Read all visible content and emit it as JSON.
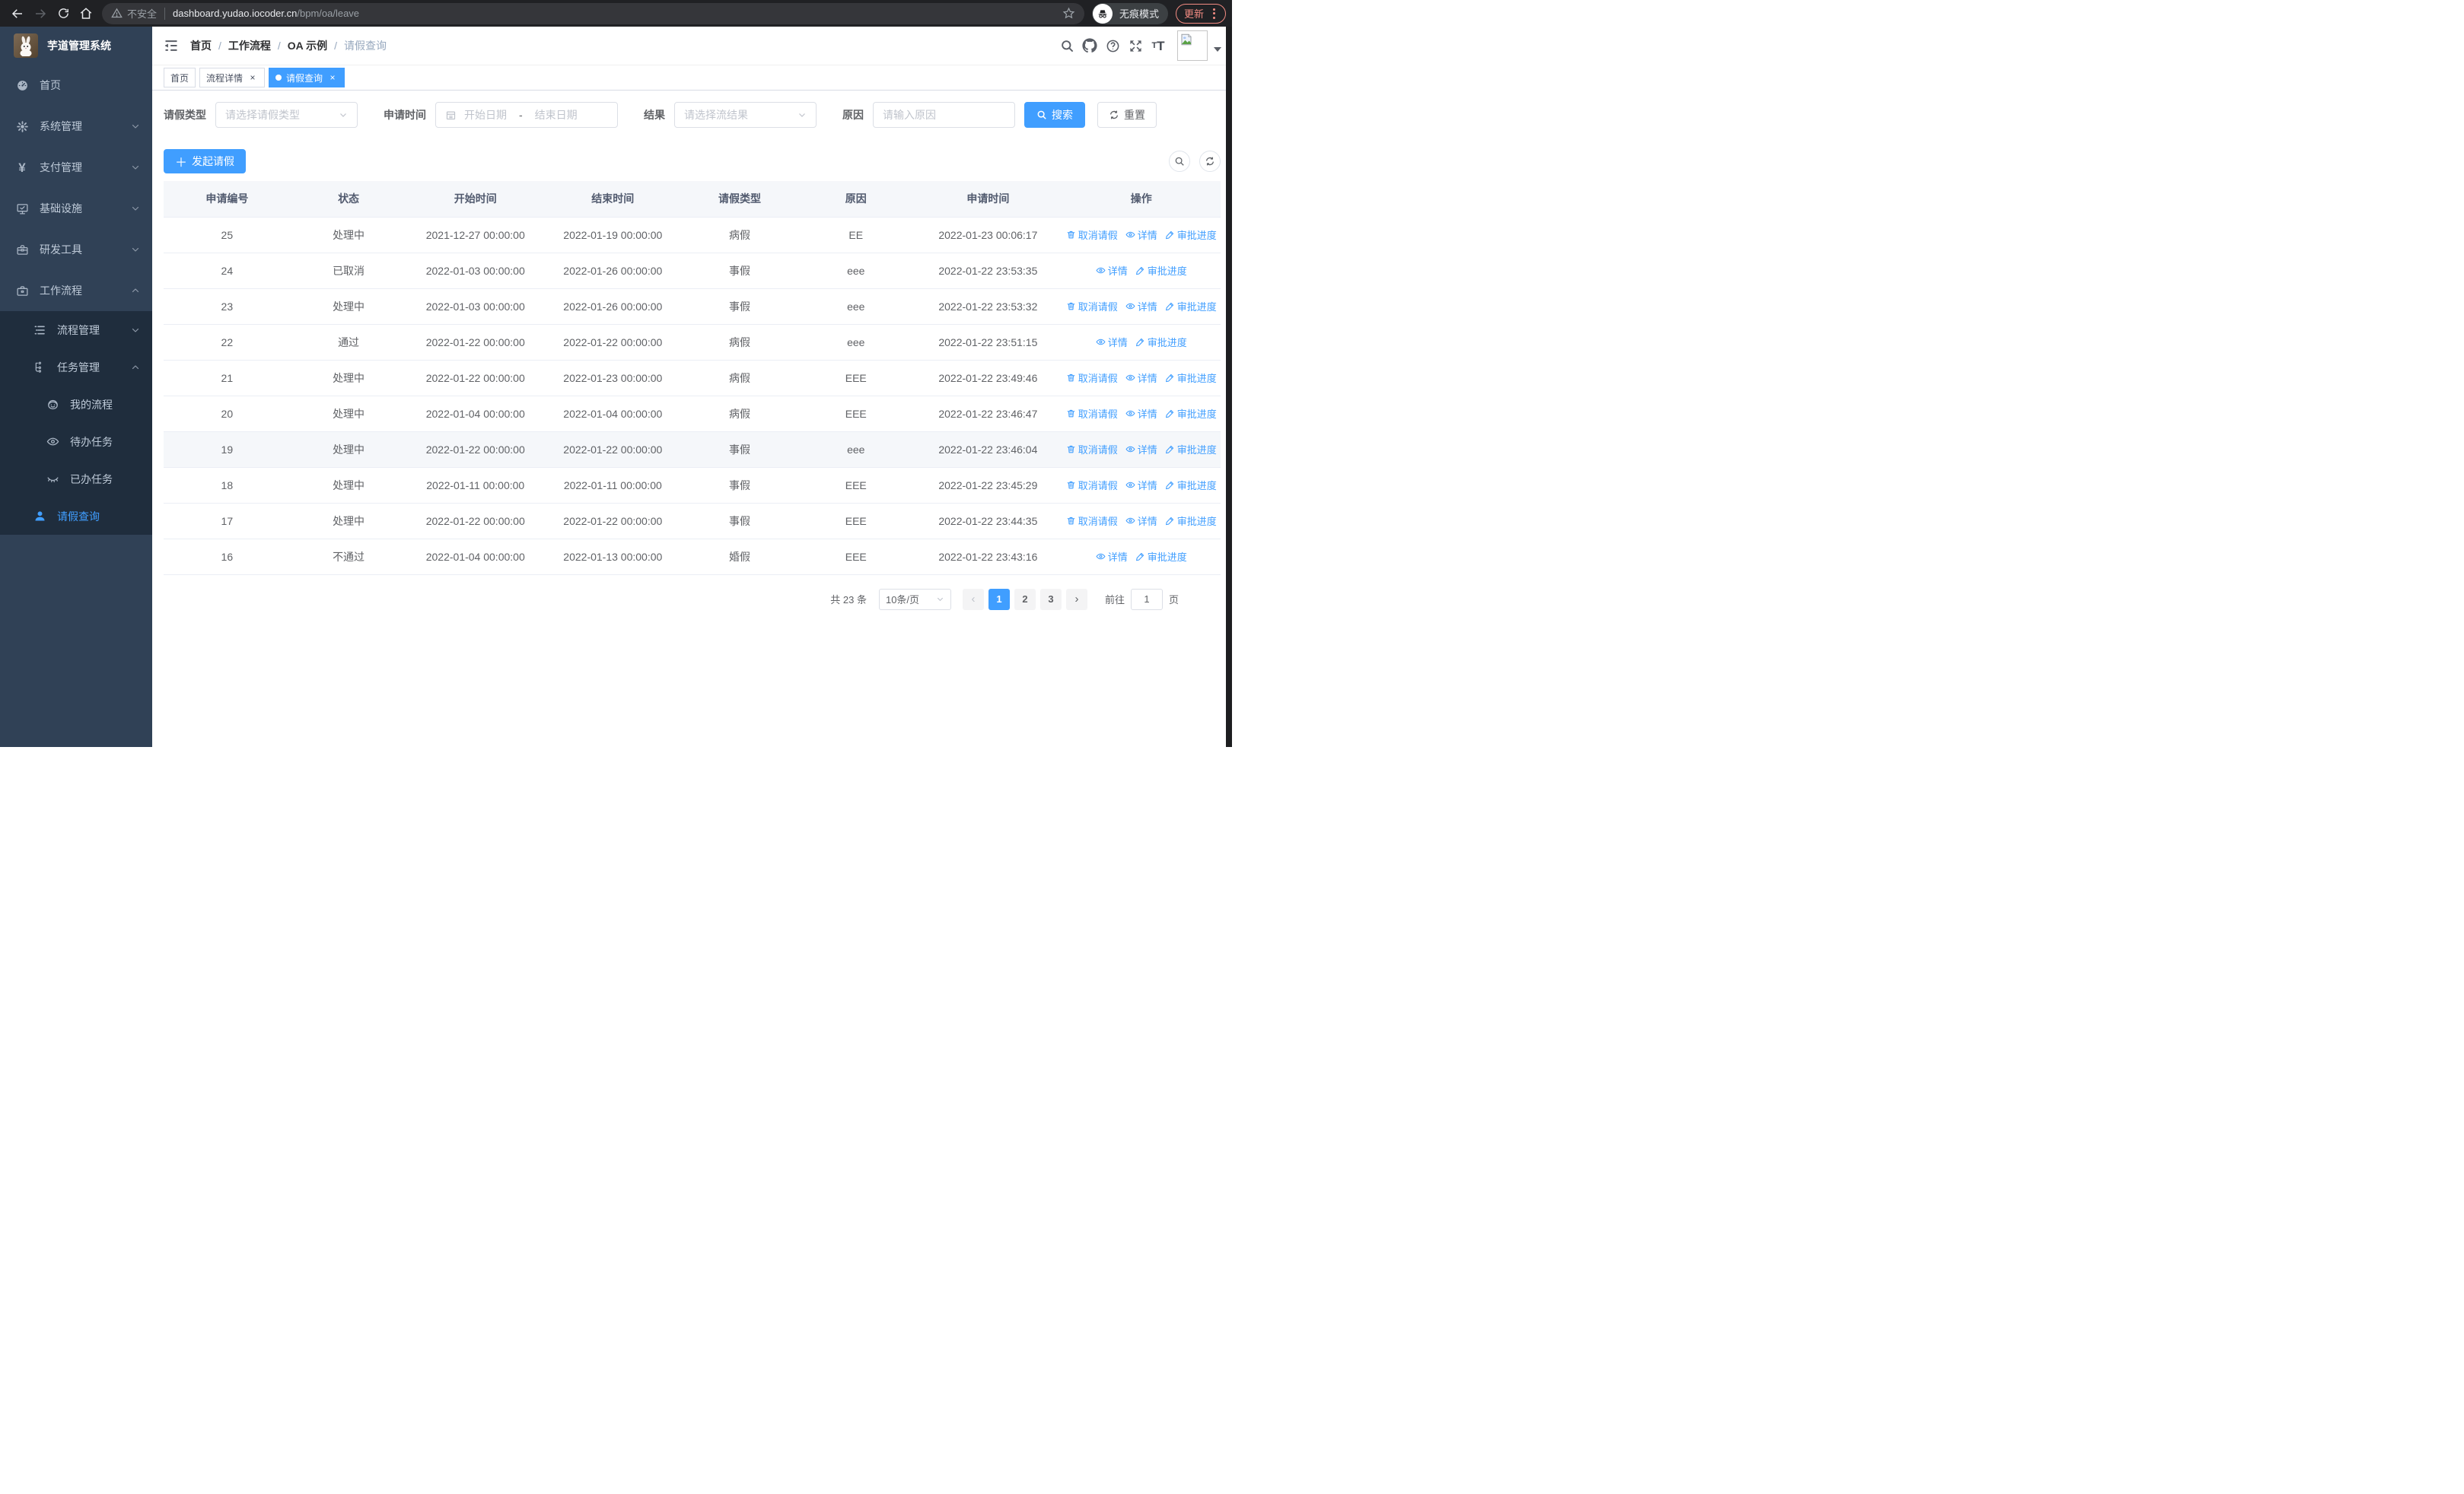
{
  "browser": {
    "security_label": "不安全",
    "url_host": "dashboard.yudao.iocoder.cn",
    "url_path": "/bpm/oa/leave",
    "incognito_label": "无痕模式",
    "update_label": "更新"
  },
  "sidebar": {
    "logo_title": "芋道管理系统",
    "items": [
      {
        "key": "home",
        "label": "首页",
        "icon": "dashboard-icon",
        "level": 1,
        "group": false,
        "chevron": null,
        "active": false
      },
      {
        "key": "system-mgmt",
        "label": "系统管理",
        "icon": "gear-icon",
        "level": 1,
        "group": false,
        "chevron": "down",
        "active": false
      },
      {
        "key": "payment-mgmt",
        "label": "支付管理",
        "icon": "yen-icon",
        "level": 1,
        "group": false,
        "chevron": "down",
        "active": false
      },
      {
        "key": "infrastructure",
        "label": "基础设施",
        "icon": "monitor-icon",
        "level": 1,
        "group": false,
        "chevron": "down",
        "active": false
      },
      {
        "key": "dev-tools",
        "label": "研发工具",
        "icon": "toolbox-icon",
        "level": 1,
        "group": false,
        "chevron": "down",
        "active": false
      },
      {
        "key": "workflow",
        "label": "工作流程",
        "icon": "briefcase-icon",
        "level": 1,
        "group": false,
        "chevron": "up",
        "active": false
      },
      {
        "key": "process-mgmt",
        "label": "流程管理",
        "icon": "list-icon",
        "level": 2,
        "group": true,
        "chevron": "down",
        "active": false
      },
      {
        "key": "task-mgmt",
        "label": "任务管理",
        "icon": "tree-icon",
        "level": 2,
        "group": true,
        "chevron": "up",
        "active": false
      },
      {
        "key": "my-process",
        "label": "我的流程",
        "icon": "robot-icon",
        "level": 3,
        "group": true,
        "chevron": null,
        "active": false
      },
      {
        "key": "todo-tasks",
        "label": "待办任务",
        "icon": "eye-icon",
        "level": 3,
        "group": true,
        "chevron": null,
        "active": false
      },
      {
        "key": "done-tasks",
        "label": "已办任务",
        "icon": "eye-closed-icon",
        "level": 3,
        "group": true,
        "chevron": null,
        "active": false
      },
      {
        "key": "leave-query",
        "label": "请假查询",
        "icon": "user-icon",
        "level": 2,
        "group": true,
        "chevron": null,
        "active": true
      }
    ]
  },
  "breadcrumb": {
    "separator": "/",
    "items": [
      "首页",
      "工作流程",
      "OA 示例",
      "请假查询"
    ]
  },
  "tabs": [
    {
      "label": "首页",
      "closable": false,
      "active": false
    },
    {
      "label": "流程详情",
      "closable": true,
      "active": false
    },
    {
      "label": "请假查询",
      "closable": true,
      "active": true
    }
  ],
  "ui": {
    "close_glyph": "×"
  },
  "filters": {
    "leave_type": {
      "label": "请假类型",
      "placeholder": "请选择请假类型"
    },
    "apply_time": {
      "label": "申请时间",
      "start_placeholder": "开始日期",
      "separator": "-",
      "end_placeholder": "结束日期"
    },
    "result": {
      "label": "结果",
      "placeholder": "请选择流结果"
    },
    "reason": {
      "label": "原因",
      "placeholder": "请输入原因"
    },
    "search_label": "搜索",
    "reset_label": "重置"
  },
  "toolbar": {
    "create_label": "发起请假"
  },
  "table": {
    "columns": [
      "申请编号",
      "状态",
      "开始时间",
      "结束时间",
      "请假类型",
      "原因",
      "申请时间",
      "操作"
    ],
    "action_labels": {
      "cancel": "取消请假",
      "detail": "详情",
      "progress": "审批进度"
    },
    "rows": [
      {
        "id": "25",
        "status": "处理中",
        "start": "2021-12-27 00:00:00",
        "end": "2022-01-19 00:00:00",
        "type": "病假",
        "reason": "EE",
        "apply_time": "2022-01-23 00:06:17",
        "actions": [
          "cancel",
          "detail",
          "progress"
        ],
        "highlighted": false
      },
      {
        "id": "24",
        "status": "已取消",
        "start": "2022-01-03 00:00:00",
        "end": "2022-01-26 00:00:00",
        "type": "事假",
        "reason": "eee",
        "apply_time": "2022-01-22 23:53:35",
        "actions": [
          "detail",
          "progress"
        ],
        "highlighted": false
      },
      {
        "id": "23",
        "status": "处理中",
        "start": "2022-01-03 00:00:00",
        "end": "2022-01-26 00:00:00",
        "type": "事假",
        "reason": "eee",
        "apply_time": "2022-01-22 23:53:32",
        "actions": [
          "cancel",
          "detail",
          "progress"
        ],
        "highlighted": false
      },
      {
        "id": "22",
        "status": "通过",
        "start": "2022-01-22 00:00:00",
        "end": "2022-01-22 00:00:00",
        "type": "病假",
        "reason": "eee",
        "apply_time": "2022-01-22 23:51:15",
        "actions": [
          "detail",
          "progress"
        ],
        "highlighted": false
      },
      {
        "id": "21",
        "status": "处理中",
        "start": "2022-01-22 00:00:00",
        "end": "2022-01-23 00:00:00",
        "type": "病假",
        "reason": "EEE",
        "apply_time": "2022-01-22 23:49:46",
        "actions": [
          "cancel",
          "detail",
          "progress"
        ],
        "highlighted": false
      },
      {
        "id": "20",
        "status": "处理中",
        "start": "2022-01-04 00:00:00",
        "end": "2022-01-04 00:00:00",
        "type": "病假",
        "reason": "EEE",
        "apply_time": "2022-01-22 23:46:47",
        "actions": [
          "cancel",
          "detail",
          "progress"
        ],
        "highlighted": false
      },
      {
        "id": "19",
        "status": "处理中",
        "start": "2022-01-22 00:00:00",
        "end": "2022-01-22 00:00:00",
        "type": "事假",
        "reason": "eee",
        "apply_time": "2022-01-22 23:46:04",
        "actions": [
          "cancel",
          "detail",
          "progress"
        ],
        "highlighted": true
      },
      {
        "id": "18",
        "status": "处理中",
        "start": "2022-01-11 00:00:00",
        "end": "2022-01-11 00:00:00",
        "type": "事假",
        "reason": "EEE",
        "apply_time": "2022-01-22 23:45:29",
        "actions": [
          "cancel",
          "detail",
          "progress"
        ],
        "highlighted": false
      },
      {
        "id": "17",
        "status": "处理中",
        "start": "2022-01-22 00:00:00",
        "end": "2022-01-22 00:00:00",
        "type": "事假",
        "reason": "EEE",
        "apply_time": "2022-01-22 23:44:35",
        "actions": [
          "cancel",
          "detail",
          "progress"
        ],
        "highlighted": false
      },
      {
        "id": "16",
        "status": "不通过",
        "start": "2022-01-04 00:00:00",
        "end": "2022-01-13 00:00:00",
        "type": "婚假",
        "reason": "EEE",
        "apply_time": "2022-01-22 23:43:16",
        "actions": [
          "detail",
          "progress"
        ],
        "highlighted": false
      }
    ]
  },
  "pagination": {
    "total_label": "共 23 条",
    "page_size": "10条/页",
    "prev_glyph": "‹",
    "next_glyph": "›",
    "pages": [
      "1",
      "2",
      "3"
    ],
    "active_page": "1",
    "goto_label": "前往",
    "goto_value": "1",
    "unit_label": "页"
  }
}
